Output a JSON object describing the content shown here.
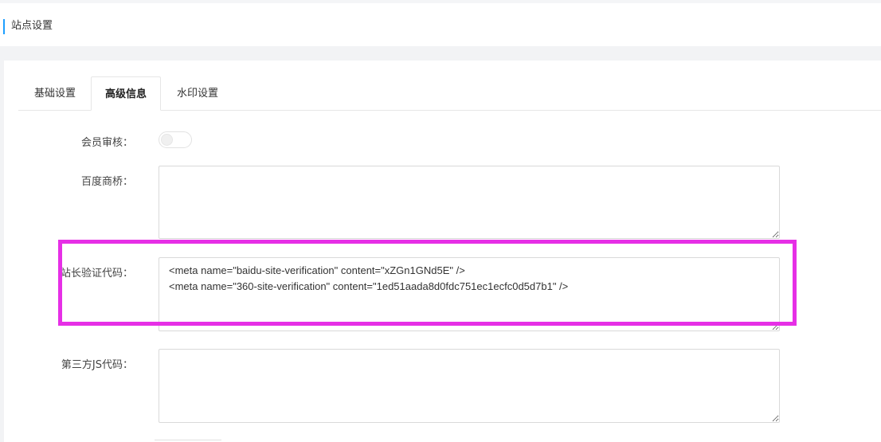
{
  "header": {
    "title": "站点设置"
  },
  "tabs": [
    {
      "label": "基础设置"
    },
    {
      "label": "高级信息"
    },
    {
      "label": "水印设置"
    }
  ],
  "form": {
    "member_review": {
      "label": "会员审核：",
      "enabled": false
    },
    "baidu_bridge": {
      "label": "百度商桥：",
      "value": ""
    },
    "webmaster_code": {
      "label": "站长验证代码：",
      "value": "<meta name=\"baidu-site-verification\" content=\"xZGn1GNd5E\" />\n<meta name=\"360-site-verification\" content=\"1ed51aada8d0fdc751ec1ecfc0d5d7b1\" />"
    },
    "third_party_js": {
      "label": "第三方JS代码：",
      "value": ""
    }
  },
  "colors": {
    "accent": "#1e9fff",
    "highlight_box": "#e62fe6"
  }
}
